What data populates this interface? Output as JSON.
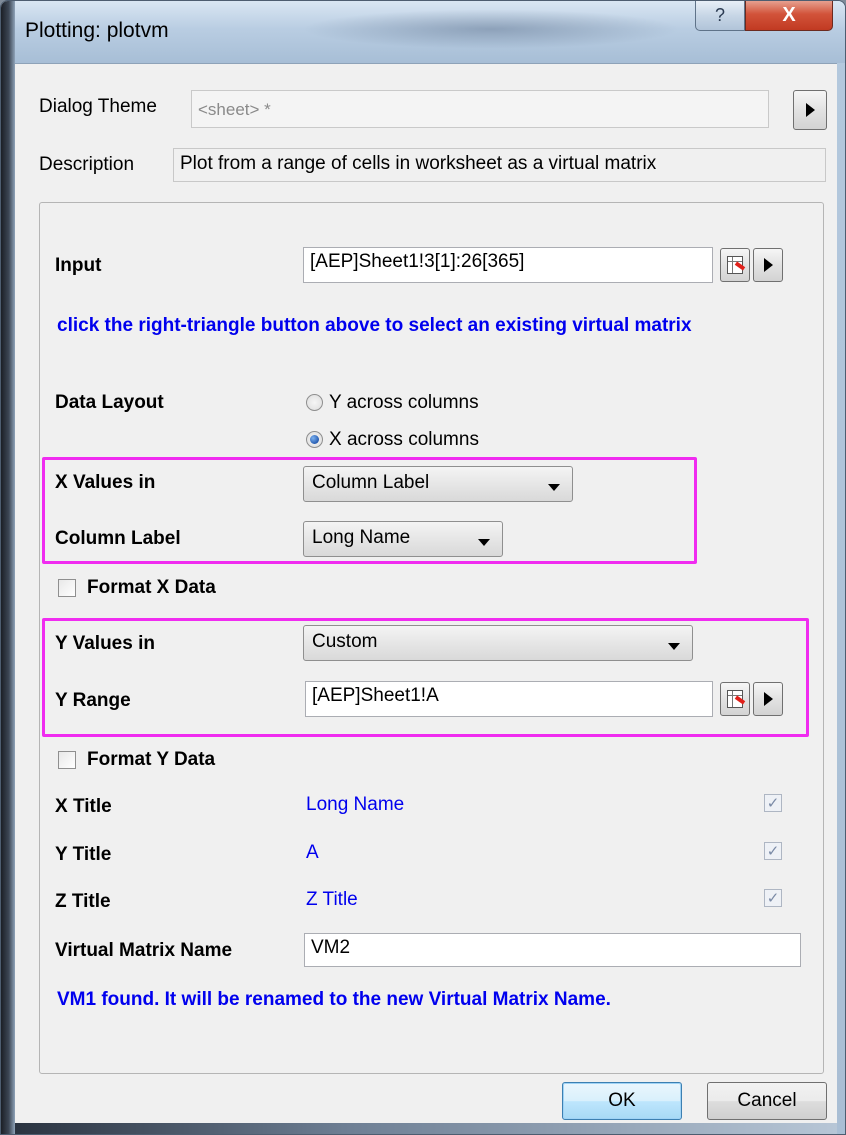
{
  "window": {
    "title": "Plotting: plotvm",
    "help_glyph": "?",
    "close_glyph": "X"
  },
  "theme": {
    "label": "Dialog Theme",
    "value": "<sheet> *"
  },
  "description": {
    "label": "Description",
    "value": "Plot from a range of cells in worksheet as a virtual matrix"
  },
  "input": {
    "label": "Input",
    "value": "[AEP]Sheet1!3[1]:26[365]",
    "hint": "click the right-triangle button above to select an existing virtual matrix"
  },
  "data_layout": {
    "label": "Data Layout",
    "options": [
      "Y across columns",
      "X across columns"
    ],
    "selected": "X across columns"
  },
  "x_values": {
    "label": "X Values in",
    "value": "Column Label"
  },
  "column_label": {
    "label": "Column Label",
    "value": "Long Name"
  },
  "format_x": {
    "label": "Format X Data",
    "checked": false
  },
  "y_values": {
    "label": "Y Values in",
    "value": "Custom"
  },
  "y_range": {
    "label": "Y Range",
    "value": "[AEP]Sheet1!A"
  },
  "format_y": {
    "label": "Format Y Data",
    "checked": false
  },
  "titles": [
    {
      "label": "X Title",
      "value": "Long Name",
      "checked": true
    },
    {
      "label": "Y Title",
      "value": "A",
      "checked": true
    },
    {
      "label": "Z Title",
      "value": "Z Title",
      "checked": true
    }
  ],
  "vm_name": {
    "label": "Virtual Matrix Name",
    "value": "VM2",
    "notice": "VM1 found. It will be renamed to the new Virtual Matrix Name."
  },
  "buttons": {
    "ok": "OK",
    "cancel": "Cancel"
  },
  "colors": {
    "highlight": "#f02cf0",
    "link_blue": "#0000ee"
  },
  "icons": {
    "check": "✓"
  }
}
